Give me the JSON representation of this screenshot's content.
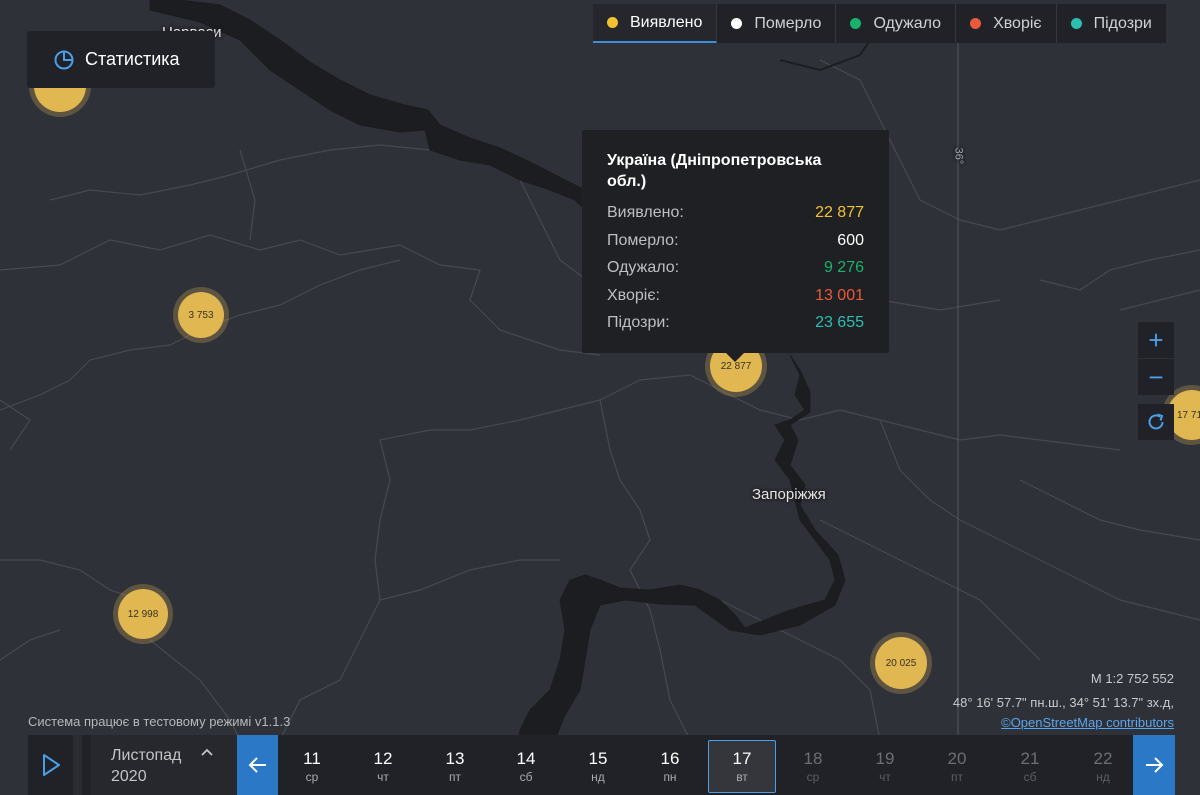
{
  "map": {
    "place_labels": {
      "zaporizhzhia": "Запоріжжя",
      "top_city": "Нарваси"
    },
    "meridian_label": "36°",
    "clusters": [
      {
        "id": "top-left",
        "value": ""
      },
      {
        "id": "west",
        "value": "3 753"
      },
      {
        "id": "center",
        "value": "22 877"
      },
      {
        "id": "southwest",
        "value": "12 998"
      },
      {
        "id": "south",
        "value": "20 025"
      },
      {
        "id": "east",
        "value": "17 71"
      }
    ]
  },
  "stats_button": {
    "label": "Статистика"
  },
  "legend": [
    {
      "label": "Виявлено",
      "color": "#f1c232",
      "active": true
    },
    {
      "label": "Померло",
      "color": "#ffffff",
      "active": false
    },
    {
      "label": "Одужало",
      "color": "#1ab26b",
      "active": false
    },
    {
      "label": "Хворіє",
      "color": "#ea5a3a",
      "active": false
    },
    {
      "label": "Підозри",
      "color": "#2bbfb0",
      "active": false
    }
  ],
  "tooltip": {
    "title": "Україна (Дніпропетровська обл.)",
    "rows": [
      {
        "label": "Виявлено:",
        "value": "22 877",
        "color": "#f1c232"
      },
      {
        "label": "Померло:",
        "value": "600",
        "color": "#ffffff"
      },
      {
        "label": "Одужало:",
        "value": "9 276",
        "color": "#1ab26b"
      },
      {
        "label": "Хворіє:",
        "value": "13 001",
        "color": "#ea5a3a"
      },
      {
        "label": "Підозри:",
        "value": "23 655",
        "color": "#2bbfb0"
      }
    ]
  },
  "zoom": {
    "in": "+",
    "out": "−"
  },
  "status_text": "Система працює в тестовому режимі v1.1.3",
  "scale_text": "M 1:2 752 552",
  "coords_text": "48° 16' 57.7\" пн.ш., 34° 51' 13.7\" зх.д,",
  "osm_link": "©OpenStreetMap contributors",
  "timeline": {
    "month": "Листопад",
    "year": "2020",
    "days": [
      {
        "num": "11",
        "dow": "ср",
        "state": "past"
      },
      {
        "num": "12",
        "dow": "чт",
        "state": "past"
      },
      {
        "num": "13",
        "dow": "пт",
        "state": "past"
      },
      {
        "num": "14",
        "dow": "сб",
        "state": "past"
      },
      {
        "num": "15",
        "dow": "нд",
        "state": "past"
      },
      {
        "num": "16",
        "dow": "пн",
        "state": "past"
      },
      {
        "num": "17",
        "dow": "вт",
        "state": "selected"
      },
      {
        "num": "18",
        "dow": "ср",
        "state": "future"
      },
      {
        "num": "19",
        "dow": "чт",
        "state": "future"
      },
      {
        "num": "20",
        "dow": "пт",
        "state": "future"
      },
      {
        "num": "21",
        "dow": "сб",
        "state": "future"
      },
      {
        "num": "22",
        "dow": "нд",
        "state": "future"
      }
    ]
  }
}
